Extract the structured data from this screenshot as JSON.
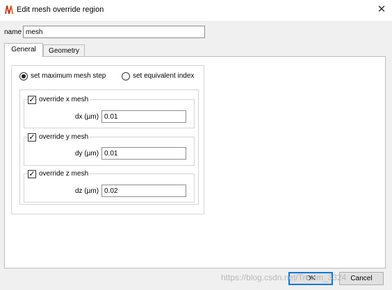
{
  "window": {
    "title": "Edit mesh override region",
    "close_icon": "close-icon",
    "app_icon": "lumerical-logo-icon",
    "accent": "#0078d7",
    "logo_colors": [
      "#c0392b",
      "#e67e22"
    ]
  },
  "name_field": {
    "label": "name",
    "value": "mesh"
  },
  "tabs": [
    {
      "label": "General",
      "active": true
    },
    {
      "label": "Geometry",
      "active": false
    }
  ],
  "mode": {
    "option_max_step": "set maximum mesh step",
    "option_equiv_index": "set equivalent index",
    "selected": "set maximum mesh step"
  },
  "overrides": [
    {
      "label": "override x mesh",
      "checked": true,
      "field_label": "dx (µm)",
      "value": "0.01"
    },
    {
      "label": "override y mesh",
      "checked": true,
      "field_label": "dy (µm)",
      "value": "0.01"
    },
    {
      "label": "override z mesh",
      "checked": true,
      "field_label": "dz (µm)",
      "value": "0.02"
    }
  ],
  "buttons": {
    "ok": "OK",
    "cancel": "Cancel"
  },
  "watermark": "https://blog.csdn.net/Trevim_3324"
}
